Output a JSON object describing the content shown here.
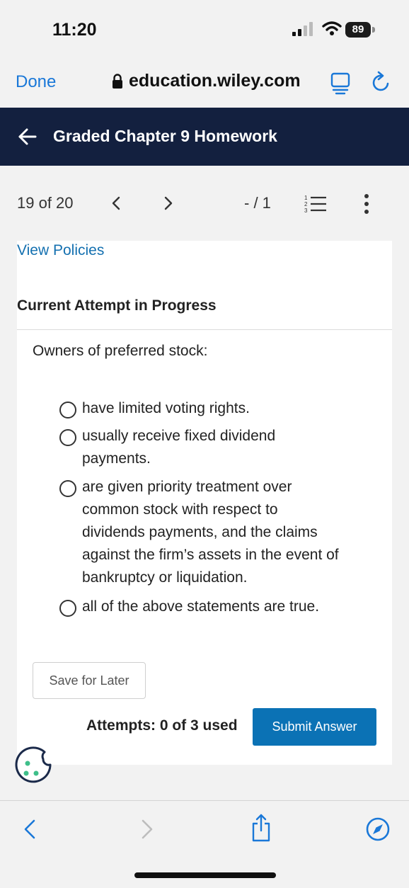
{
  "status_bar": {
    "time": "11:20",
    "battery": "89"
  },
  "browser": {
    "done_label": "Done",
    "url": "education.wiley.com"
  },
  "header": {
    "title": "Graded Chapter 9 Homework"
  },
  "nav": {
    "position": "19 of 20",
    "score": "- / 1"
  },
  "content": {
    "view_policies": "View Policies",
    "attempt_heading": "Current Attempt in Progress",
    "question": "Owners of preferred stock:",
    "options": [
      {
        "text": "have limited voting rights.",
        "selected": false
      },
      {
        "text": "usually receive fixed dividend payments.",
        "selected": false
      },
      {
        "text": "are given priority treatment over common stock with respect to dividends payments, and the claims against the firm’s assets in the event of bankruptcy or liquidation.",
        "selected": false
      },
      {
        "text": "all of the above statements are true.",
        "selected": false
      }
    ],
    "save_label": "Save for Later",
    "attempts_text": "Attempts: 0 of 3 used",
    "submit_label": "Submit Answer"
  },
  "colors": {
    "header_bg": "#13203f",
    "link": "#1470b0",
    "submit_bg": "#0b72b5",
    "safari_blue": "#1a78d8"
  },
  "icons": [
    "signal-icon",
    "wifi-icon",
    "battery-icon",
    "lock-icon",
    "reader-icon",
    "reload-icon",
    "back-arrow-icon",
    "chevron-left-icon",
    "chevron-right-icon",
    "numbered-list-icon",
    "more-vertical-icon",
    "cookie-icon",
    "share-icon",
    "compass-icon"
  ]
}
